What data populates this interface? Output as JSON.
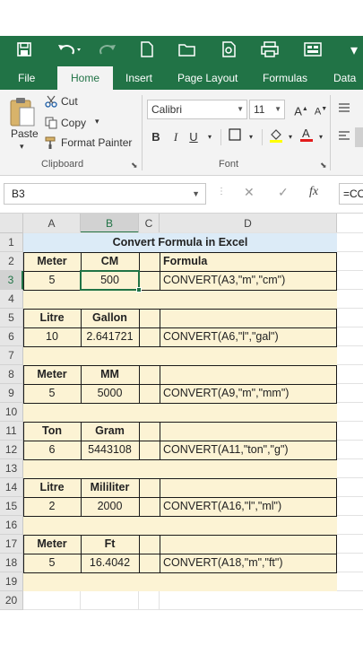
{
  "ribbon_tabs": [
    "File",
    "Home",
    "Insert",
    "Page Layout",
    "Formulas",
    "Data"
  ],
  "active_tab": "Home",
  "clipboard": {
    "cut": "Cut",
    "copy": "Copy",
    "paste": "Paste",
    "format_painter": "Format Painter",
    "group_label": "Clipboard"
  },
  "font_group": {
    "font_name": "Calibri",
    "font_size": "11",
    "bold": "B",
    "italic": "I",
    "underline": "U",
    "group_label": "Font"
  },
  "formula_bar": {
    "name_box": "B3",
    "fx": "fx",
    "content": "=CO"
  },
  "colors": {
    "excel_green": "#217346",
    "table_fill": "#fcf3d4",
    "title_fill": "#dcebf7"
  },
  "columns": [
    "A",
    "B",
    "C",
    "D"
  ],
  "rows": [
    "1",
    "2",
    "3",
    "4",
    "5",
    "6",
    "7",
    "8",
    "9",
    "10",
    "11",
    "12",
    "13",
    "14",
    "15",
    "16",
    "17",
    "18",
    "19",
    "20"
  ],
  "sheet": {
    "title": "Convert Formula in Excel",
    "formula_header": "Formula",
    "blocks": [
      {
        "unit_from": "Meter",
        "unit_to": "CM",
        "input": "5",
        "result": "500",
        "formula": "CONVERT(A3,\"m\",\"cm\")"
      },
      {
        "unit_from": "Litre",
        "unit_to": "Gallon",
        "input": "10",
        "result": "2.641721",
        "formula": "CONVERT(A6,\"l\",\"gal\")"
      },
      {
        "unit_from": "Meter",
        "unit_to": "MM",
        "input": "5",
        "result": "5000",
        "formula": "CONVERT(A9,\"m\",\"mm\")"
      },
      {
        "unit_from": "Ton",
        "unit_to": "Gram",
        "input": "6",
        "result": "5443108",
        "formula": "CONVERT(A11,\"ton\",\"g\")"
      },
      {
        "unit_from": "Litre",
        "unit_to": "Mililiter",
        "input": "2",
        "result": "2000",
        "formula": "CONVERT(A16,\"l\",\"ml\")"
      },
      {
        "unit_from": "Meter",
        "unit_to": "Ft",
        "input": "5",
        "result": "16.4042",
        "formula": "CONVERT(A18,\"m\",\"ft\")"
      }
    ]
  }
}
